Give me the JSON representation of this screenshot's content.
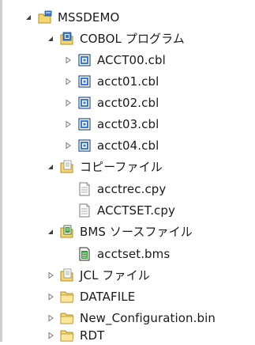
{
  "tree": {
    "project": {
      "label": "MSSDEMO",
      "expanded": true
    },
    "folders": [
      {
        "label": "COBOL プログラム",
        "expanded": true,
        "items": [
          {
            "label": "ACCT00.cbl"
          },
          {
            "label": "acct01.cbl"
          },
          {
            "label": "acct02.cbl"
          },
          {
            "label": "acct03.cbl"
          },
          {
            "label": "acct04.cbl"
          }
        ]
      },
      {
        "label": "コピーファイル",
        "expanded": true,
        "items": [
          {
            "label": "acctrec.cpy"
          },
          {
            "label": "ACCTSET.cpy"
          }
        ]
      },
      {
        "label": "BMS ソースファイル",
        "expanded": true,
        "items": [
          {
            "label": "acctset.bms"
          }
        ]
      },
      {
        "label": "JCL ファイル",
        "expanded": false
      },
      {
        "label": "DATAFILE",
        "expanded": false
      },
      {
        "label": "New_Configuration.bin",
        "expanded": false
      },
      {
        "label": "RDT",
        "expanded": false
      }
    ]
  }
}
